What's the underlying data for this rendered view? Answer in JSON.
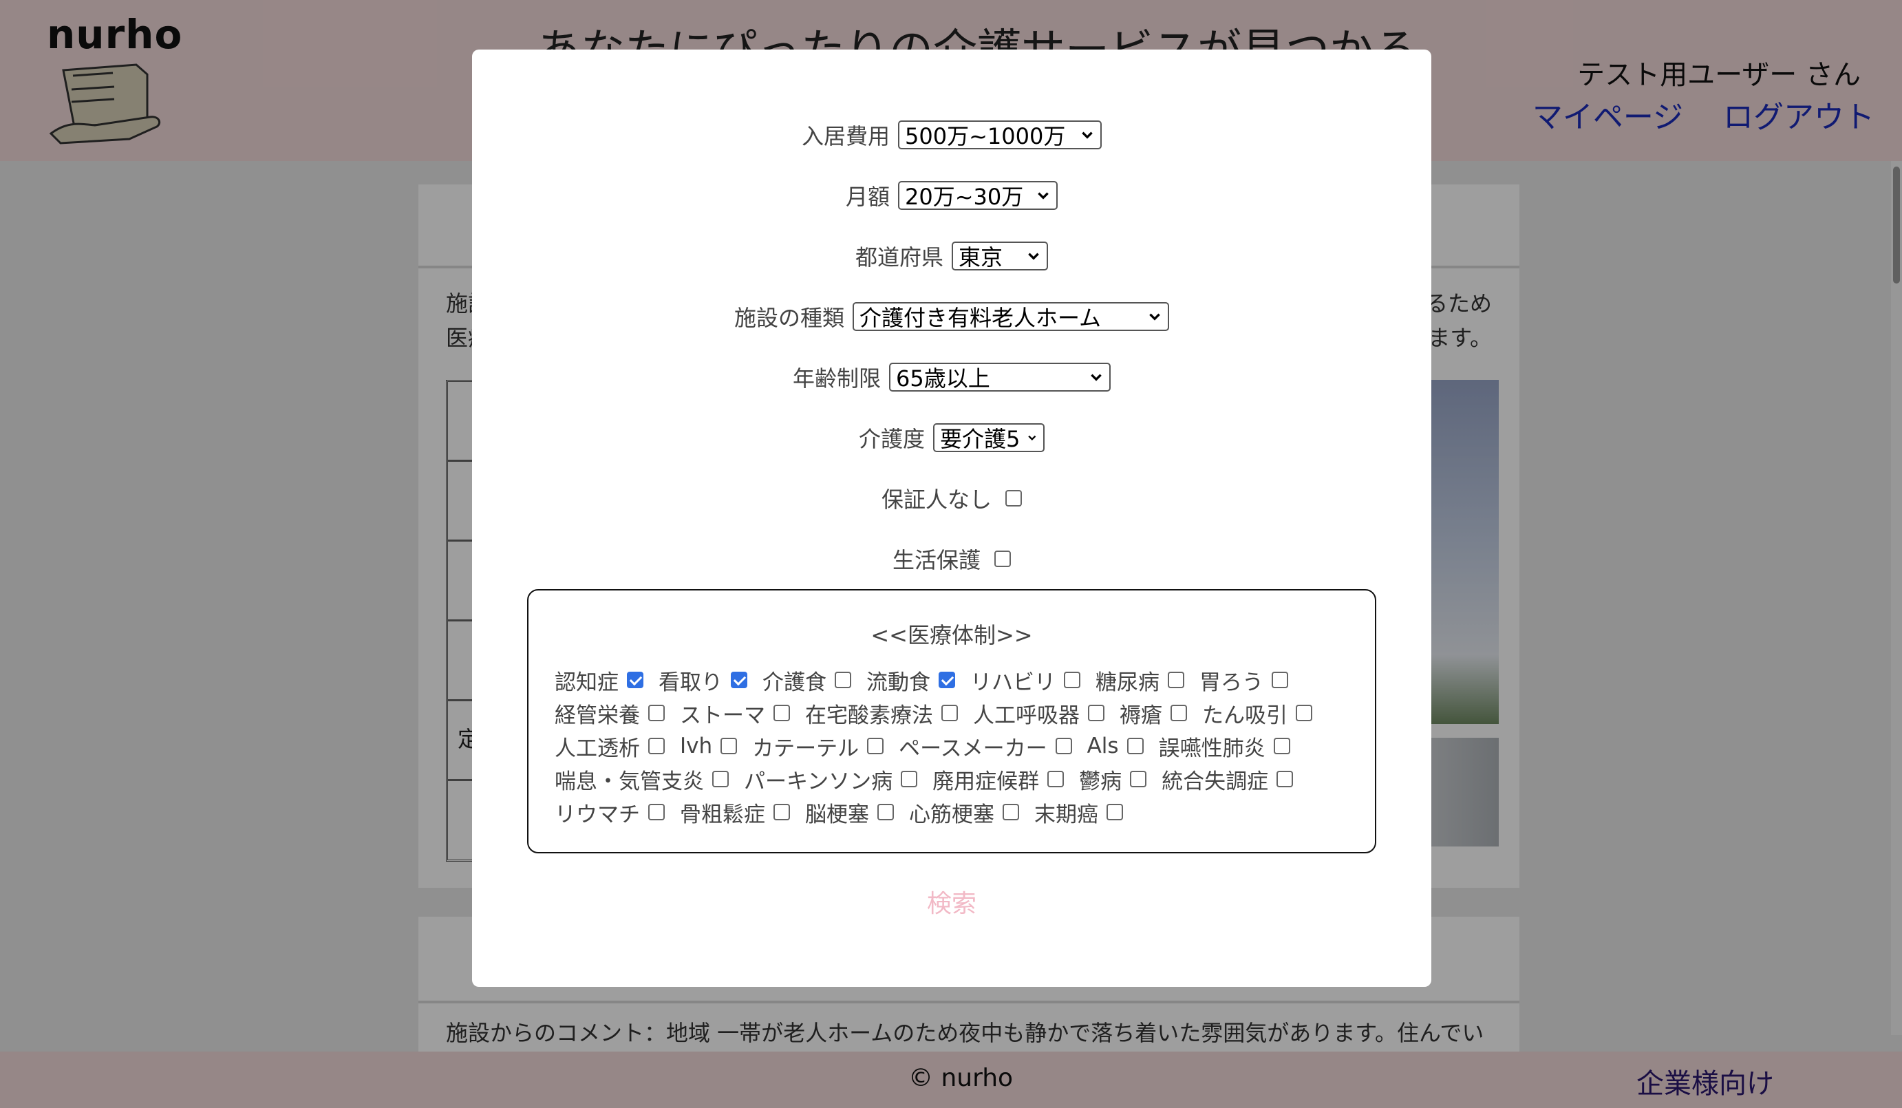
{
  "header": {
    "logo_text": "nurho",
    "tagline": "あなたにぴったりの介護サービスが見つかる",
    "user_name": "テスト用ユーザー さん",
    "mypage_link": "マイページ",
    "logout_link": "ログアウト"
  },
  "background": {
    "desc_line1": "施設",
    "desc_line1_end": "るため",
    "desc_line2": "医療",
    "desc_line2_end": "ます。",
    "table_cell": "定",
    "comment_text": "施設からのコメント：地域 一帯が老人ホームのため夜中も静かで落ち着いた雰囲気があります。住んでい"
  },
  "modal": {
    "fields": [
      {
        "label": "入居費用",
        "value": "500万~1000万"
      },
      {
        "label": "月額",
        "value": "20万~30万"
      },
      {
        "label": "都道府県",
        "value": "東京"
      },
      {
        "label": "施設の種類",
        "value": "介護付き有料老人ホーム"
      },
      {
        "label": "年齢制限",
        "value": "65歳以上"
      },
      {
        "label": "介護度",
        "value": "要介護5"
      }
    ],
    "no_guarantor_label": "保証人なし",
    "no_guarantor_checked": false,
    "welfare_label": "生活保護",
    "welfare_checked": false,
    "medical_title": "<<医療体制>>",
    "medical_items": [
      {
        "label": "認知症",
        "checked": true
      },
      {
        "label": "看取り",
        "checked": true
      },
      {
        "label": "介護食",
        "checked": false
      },
      {
        "label": "流動食",
        "checked": true
      },
      {
        "label": "リハビリ",
        "checked": false
      },
      {
        "label": "糖尿病",
        "checked": false
      },
      {
        "label": "胃ろう",
        "checked": false
      },
      {
        "label": "経管栄養",
        "checked": false
      },
      {
        "label": "ストーマ",
        "checked": false
      },
      {
        "label": "在宅酸素療法",
        "checked": false
      },
      {
        "label": "人工呼吸器",
        "checked": false
      },
      {
        "label": "褥瘡",
        "checked": false
      },
      {
        "label": "たん吸引",
        "checked": false
      },
      {
        "label": "人工透析",
        "checked": false
      },
      {
        "label": "Ivh",
        "checked": false
      },
      {
        "label": "カテーテル",
        "checked": false
      },
      {
        "label": "ペースメーカー",
        "checked": false
      },
      {
        "label": "Als",
        "checked": false
      },
      {
        "label": "誤嚥性肺炎",
        "checked": false
      },
      {
        "label": "喘息・気管支炎",
        "checked": false
      },
      {
        "label": "パーキンソン病",
        "checked": false
      },
      {
        "label": "廃用症候群",
        "checked": false
      },
      {
        "label": "鬱病",
        "checked": false
      },
      {
        "label": "統合失調症",
        "checked": false
      },
      {
        "label": "リウマチ",
        "checked": false
      },
      {
        "label": "骨粗鬆症",
        "checked": false
      },
      {
        "label": "脳梗塞",
        "checked": false
      },
      {
        "label": "心筋梗塞",
        "checked": false
      },
      {
        "label": "末期癌",
        "checked": false
      }
    ],
    "search_label": "検索"
  },
  "footer": {
    "copyright": "© nurho",
    "corporate_link": "企業様向け"
  },
  "colors": {
    "header_bg": "#f3dada",
    "link": "#1a2ab8",
    "checkbox_checked": "#2f6fe3",
    "search_text": "#f2b9c6"
  }
}
